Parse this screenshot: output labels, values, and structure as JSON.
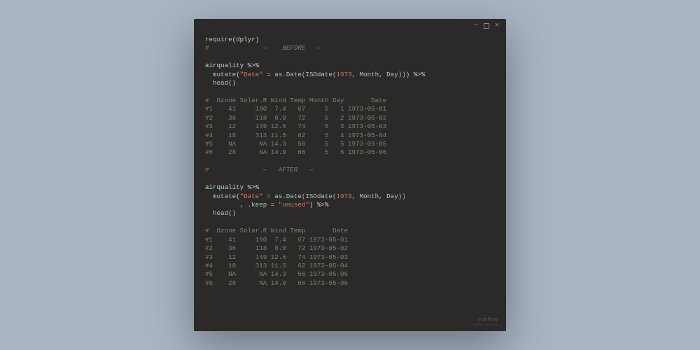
{
  "window": {
    "minimize": "—",
    "maximize": "",
    "close": "×"
  },
  "code": {
    "l1a": "require",
    "l1b": "(dplyr)",
    "l2": "#              —    BEFORE   —",
    "l3": "",
    "l4a": "airquality ",
    "l4b": "%>%",
    "l5a": "  mutate",
    "l5b": "(",
    "l5c": "\"Date\"",
    "l5d": " = as.Date(ISOdate(",
    "l5e": "1973",
    "l5f": ", Month, Day))) ",
    "l5g": "%>%",
    "l6a": "  head",
    "l6b": "()",
    "l7": "",
    "l8": "#  Ozone Solar.R Wind Temp Month Day       Date",
    "l9": "#1    41     190  7.4   67     5   1 1973-05-01",
    "l10": "#2    36     118  8.0   72     5   2 1973-05-02",
    "l11": "#3    12     149 12.6   74     5   3 1973-05-03",
    "l12": "#4    18     313 11.5   62     5   4 1973-05-04",
    "l13": "#5    NA      NA 14.3   56     5   5 1973-05-05",
    "l14": "#6    28      NA 14.9   66     5   6 1973-05-06",
    "l15": "",
    "l16": "#              —   AFTER   —",
    "l17": "",
    "l18a": "airquality ",
    "l18b": "%>%",
    "l19a": "  mutate",
    "l19b": "(",
    "l19c": "\"Date\"",
    "l19d": " = as.Date(ISOdate(",
    "l19e": "1973",
    "l19f": ", Month, Day))",
    "l20a": "         , .keep = ",
    "l20b": "\"unused\"",
    "l20c": ") ",
    "l20d": "%>%",
    "l21a": "  head",
    "l21b": "()",
    "l22": "",
    "l23": "#  Ozone Solar.R Wind Temp       Date",
    "l24": "#1    41     190  7.4   67 1973-05-01",
    "l25": "#2    36     118  8.0   72 1973-05-02",
    "l26": "#3    12     149 12.6   74 1973-05-03",
    "l27": "#4    18     313 11.5   62 1973-05-04",
    "l28": "#5    NA      NA 14.3   56 1973-05-05",
    "l29": "#6    28      NA 14.9   66 1973-05-06"
  },
  "watermark": {
    "main": "carbon",
    "sub": "carbon.now.sh"
  }
}
